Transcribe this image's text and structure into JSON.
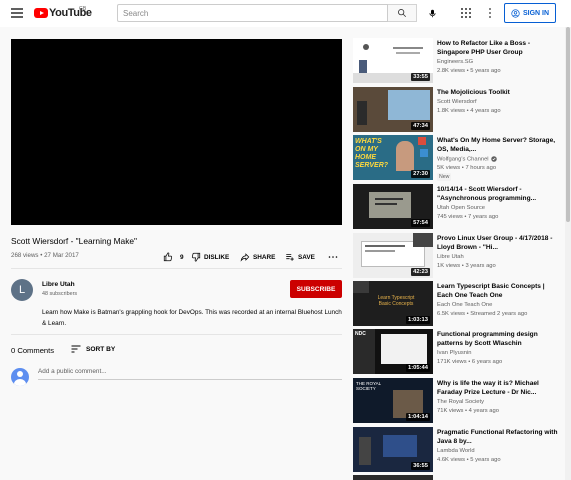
{
  "header": {
    "logo_text": "YouTube",
    "region": "GB",
    "search_placeholder": "Search",
    "signin_label": "SIGN IN",
    "icons": [
      "menu-icon",
      "search-icon",
      "mic-icon",
      "apps-icon",
      "more-vert-icon",
      "account-icon"
    ]
  },
  "video": {
    "title": "Scott Wiersdorf - \"Learning Make\"",
    "meta": "268 views • 27 Mar 2017",
    "likes": "9",
    "dislike_label": "DISLIKE",
    "share_label": "SHARE",
    "save_label": "SAVE"
  },
  "channel": {
    "initial": "L",
    "name": "Libre Utah",
    "subscribers": "48 subscribers",
    "subscribe_label": "SUBSCRIBE",
    "description": "Learn how Make is Batman's grappling hook for DevOps. This was recorded at an internal Bluehost Lunch & Learn."
  },
  "comments": {
    "count": "0 Comments",
    "sort_label": "SORT BY",
    "placeholder": "Add a public comment..."
  },
  "recommendations": [
    {
      "title": "How to Refactor Like a Boss - Singapore PHP User Group",
      "channel": "Engineers.SG",
      "meta": "2.8K views • 5 years ago",
      "duration": "33:55"
    },
    {
      "title": "The Mojolicious Toolkit",
      "channel": "Scott Wiersdorf",
      "meta": "1.8K views • 4 years ago",
      "duration": "47:34"
    },
    {
      "title": "What's On My Home Server? Storage, OS, Media,...",
      "channel": "Wolfgang's Channel",
      "meta": "5K views • 7 hours ago",
      "badge": "New",
      "duration": "27:30"
    },
    {
      "title": "10/14/14 - Scott Wiersdorf - \"Asynchronous programming...",
      "channel": "Utah Open Source",
      "meta": "745 views • 7 years ago",
      "duration": "57:54"
    },
    {
      "title": "Provo Linux User Group - 4/17/2018 - Lloyd Brown - \"Hi...",
      "channel": "Libre Utah",
      "meta": "1K views • 3 years ago",
      "duration": "42:23"
    },
    {
      "title": "Learn Typescript Basic Concepts | Each One Teach One",
      "channel": "Each One Teach One",
      "meta": "6.5K views • Streamed 2 years ago",
      "duration": "1:03:13"
    },
    {
      "title": "Functional programming design patterns by Scott Wlaschin",
      "channel": "Ivan Plyusnin",
      "meta": "171K views • 6 years ago",
      "duration": "1:05:44"
    },
    {
      "title": "Why is life the way it is? Michael Faraday Prize Lecture - Dr Nic...",
      "channel": "The Royal Society",
      "meta": "71K views • 4 years ago",
      "duration": "1:04:14"
    },
    {
      "title": "Pragmatic Functional Refactoring with Java 8 by...",
      "channel": "Lambda World",
      "meta": "4.6K views • 5 years ago",
      "duration": "36:55"
    }
  ]
}
